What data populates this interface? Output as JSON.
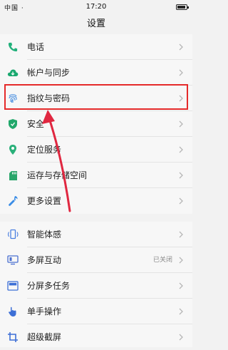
{
  "status_bar": {
    "time": "17:20",
    "carrier": "中国 ·"
  },
  "title": "设置",
  "section1": [
    {
      "label": "电话",
      "icon": "phone-icon",
      "color": "#21b07a"
    },
    {
      "label": "帐户与同步",
      "icon": "cloud-sync-icon",
      "color": "#1aa86f"
    },
    {
      "label": "指纹与密码",
      "icon": "fingerprint-icon",
      "color": "#4a8fe0"
    },
    {
      "label": "安全",
      "icon": "shield-icon",
      "color": "#21a86b"
    },
    {
      "label": "定位服务",
      "icon": "location-pin-icon",
      "color": "#2ab07a"
    },
    {
      "label": "运存与存储空间",
      "icon": "sd-card-icon",
      "color": "#2aa66b"
    },
    {
      "label": "更多设置",
      "icon": "wrench-icon",
      "color": "#3b8de6"
    }
  ],
  "section2": [
    {
      "label": "智能体感",
      "icon": "motion-phone-icon",
      "color": "#4a7fe0"
    },
    {
      "label": "多屏互动",
      "icon": "multi-screen-icon",
      "color": "#4a6fd0",
      "value": "已关闭"
    },
    {
      "label": "分屏多任务",
      "icon": "split-screen-icon",
      "color": "#3d6fd6"
    },
    {
      "label": "单手操作",
      "icon": "hand-icon",
      "color": "#3d6fd6"
    },
    {
      "label": "超级截屏",
      "icon": "screenshot-icon",
      "color": "#3d6fd6"
    }
  ],
  "annotation": {
    "highlight_color": "#e52a2a"
  }
}
